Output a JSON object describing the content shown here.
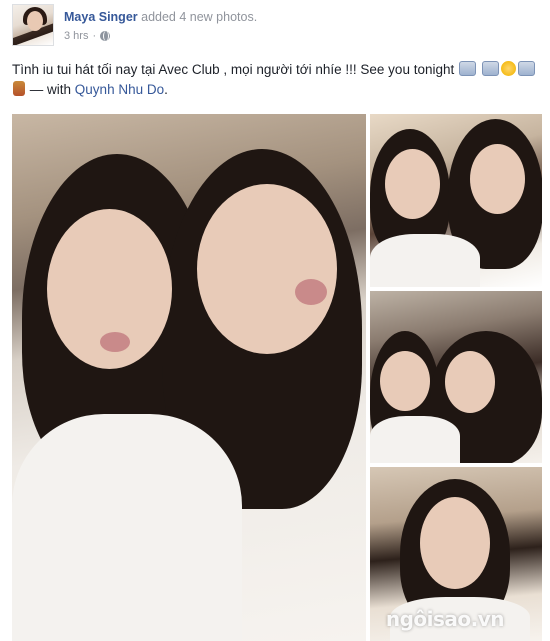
{
  "post": {
    "author": "Maya Singer",
    "action": "added 4 new photos.",
    "timestamp": "3 hrs",
    "separator": "·",
    "privacy_icon": "globe-icon",
    "text_before": "Tình iu tui hát tối nay tại Avec Club , mọi người tới nhíe !!! See you tonight",
    "with_prefix": "— with",
    "tagged_user": "Quynh Nhu Do",
    "text_end": "."
  },
  "photos": {
    "main_alt": "Photo: two women posing for a selfie",
    "photo1_alt": "Photo: two women smiling",
    "photo2_alt": "Photo: two women posing",
    "photo3_alt": "Photo: woman portrait",
    "watermark": "ngôisao.vn"
  },
  "colors": {
    "link": "#365899",
    "meta": "#90949c",
    "text": "#1d2129"
  }
}
